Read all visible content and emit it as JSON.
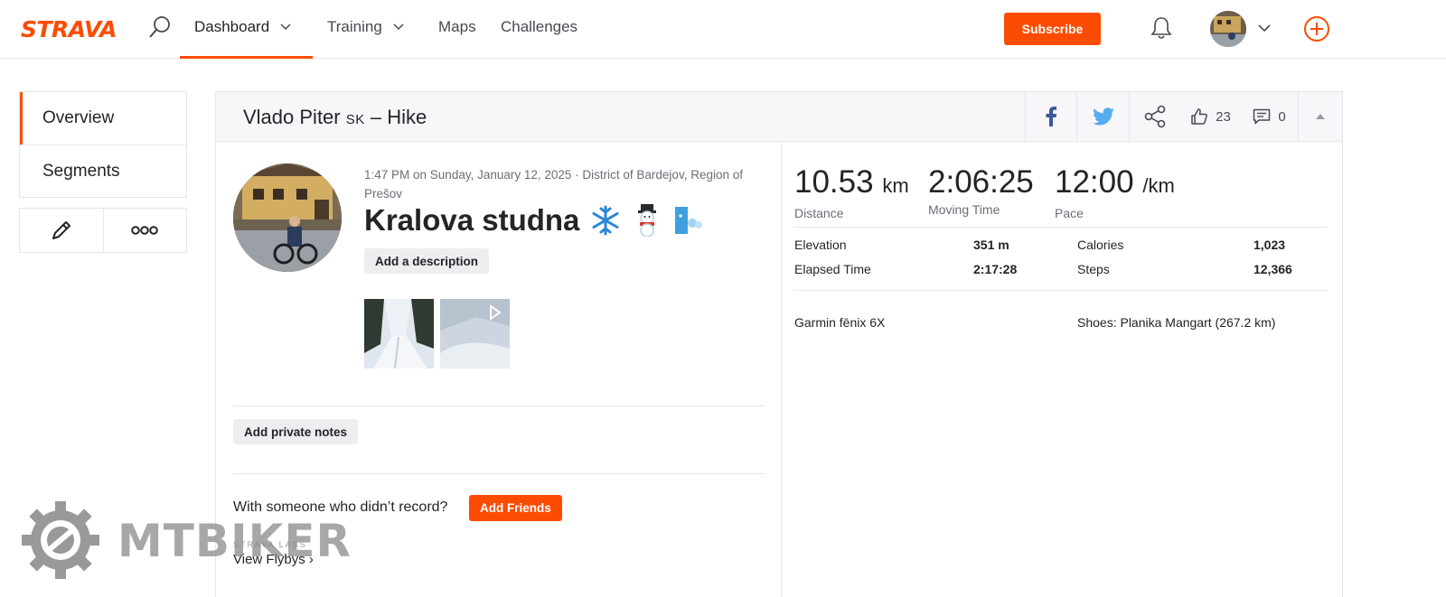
{
  "nav": {
    "logo": "STRAVA",
    "items": [
      {
        "label": "Dashboard"
      },
      {
        "label": "Training"
      },
      {
        "label": "Maps"
      },
      {
        "label": "Challenges"
      }
    ],
    "subscribe": "Subscribe",
    "accent": "#fc4c02"
  },
  "sidebar": {
    "items": [
      {
        "label": "Overview"
      },
      {
        "label": "Segments"
      }
    ]
  },
  "activity": {
    "athlete": "Vlado Piter",
    "country_badge": "SK",
    "title_suffix": "– Hike",
    "kudos_count": "23",
    "comment_count": "0",
    "meta": "1:47 PM on Sunday, January 12, 2025 · District of Bardejov, Region of Prešov",
    "name": "Kralova studna",
    "emojis": [
      "❄️",
      "⛄"
    ],
    "add_description": "Add a description",
    "add_private_notes": "Add private notes",
    "with_someone": "With someone who didn’t record?",
    "add_friends": "Add Friends",
    "labs": "STRAVA LABS",
    "view_flybys": "View Flybys",
    "stats": {
      "distance": {
        "value": "10.53",
        "unit": "km",
        "label": "Distance"
      },
      "moving_time": {
        "value": "2:06:25",
        "label": "Moving Time"
      },
      "pace": {
        "value": "12:00",
        "unit": "/km",
        "label": "Pace"
      }
    },
    "details": {
      "elevation_label": "Elevation",
      "elevation": "351 m",
      "elapsed_label": "Elapsed Time",
      "elapsed": "2:17:28",
      "calories_label": "Calories",
      "calories": "1,023",
      "steps_label": "Steps",
      "steps": "12,366"
    },
    "device": "Garmin fēnix 6X",
    "gear": "Shoes: Planika Mangart (267.2 km)"
  },
  "watermark": {
    "text": "MTBIKER"
  }
}
